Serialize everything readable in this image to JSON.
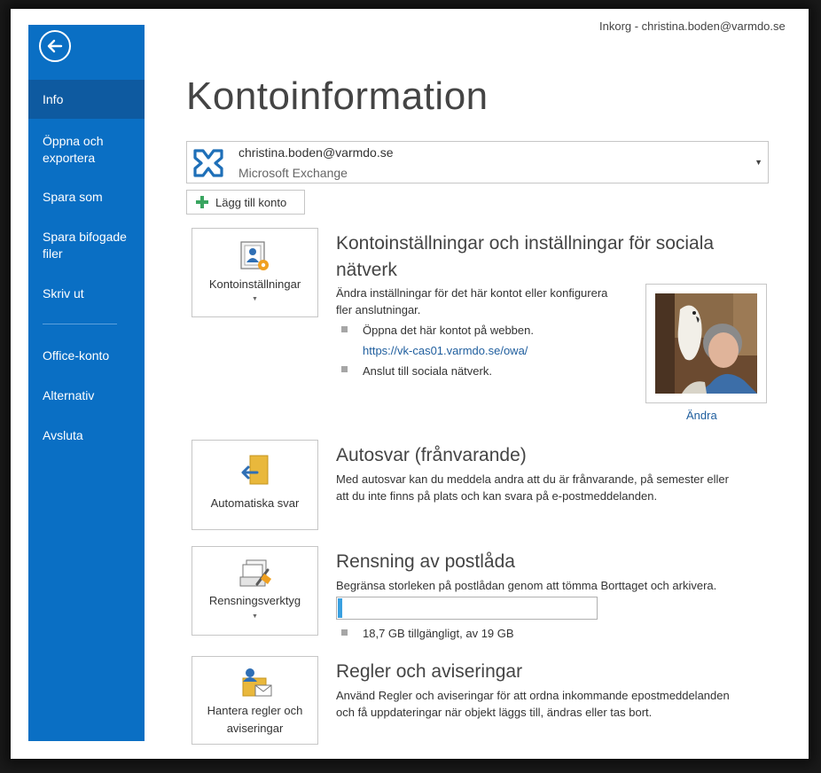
{
  "window": {
    "title": "Inkorg - christina.boden@varmdo.se"
  },
  "sidebar": {
    "items": [
      {
        "label": "Info",
        "active": true
      },
      {
        "label": "Öppna och exportera"
      },
      {
        "label": "Spara som"
      },
      {
        "label": "Spara bifogade filer"
      },
      {
        "label": "Skriv ut"
      },
      {
        "label": "Office-konto"
      },
      {
        "label": "Alternativ"
      },
      {
        "label": "Avsluta"
      }
    ],
    "accent": "#0a6fc4",
    "active_bg": "#0e5aa0"
  },
  "page": {
    "title": "Kontoinformation"
  },
  "account": {
    "email": "christina.boden@varmdo.se",
    "type": "Microsoft Exchange",
    "icon": "exchange-icon"
  },
  "add_account": {
    "label": "Lägg till konto"
  },
  "sections": {
    "account_settings": {
      "tile_label": "Kontoinställningar",
      "title_line1": "Kontoinställningar och inställningar för sociala",
      "title_line2": "nätverk",
      "desc_line1": "Ändra inställningar för det här kontot eller konfigurera",
      "desc_line2": "fler anslutningar.",
      "bullet1": "Öppna det här kontot på webben.",
      "web_link": "https://vk-cas01.varmdo.se/owa/",
      "bullet2": "Anslut till sociala nätverk.",
      "change_photo": "Ändra"
    },
    "auto_reply": {
      "tile_label": "Automatiska svar",
      "title": "Autosvar (frånvarande)",
      "desc_line1": "Med autosvar kan du meddela andra att du är frånvarande, på semester eller",
      "desc_line2": "att du inte finns på plats och kan svara på e-postmeddelanden."
    },
    "cleanup": {
      "tile_label": "Rensningsverktyg",
      "title": "Rensning av postlåda",
      "desc": "Begränsa storleken på postlådan genom att tömma Borttaget och arkivera.",
      "quota_text": "18,7 GB tillgängligt, av 19 GB",
      "used_fraction": 0.016
    },
    "rules": {
      "tile_label_line1": "Hantera regler och",
      "tile_label_line2": "aviseringar",
      "title": "Regler och aviseringar",
      "desc_line1": "Använd Regler och aviseringar för att ordna inkommande epostmeddelanden",
      "desc_line2": "och få uppdateringar när objekt läggs till, ändras eller tas bort."
    }
  }
}
